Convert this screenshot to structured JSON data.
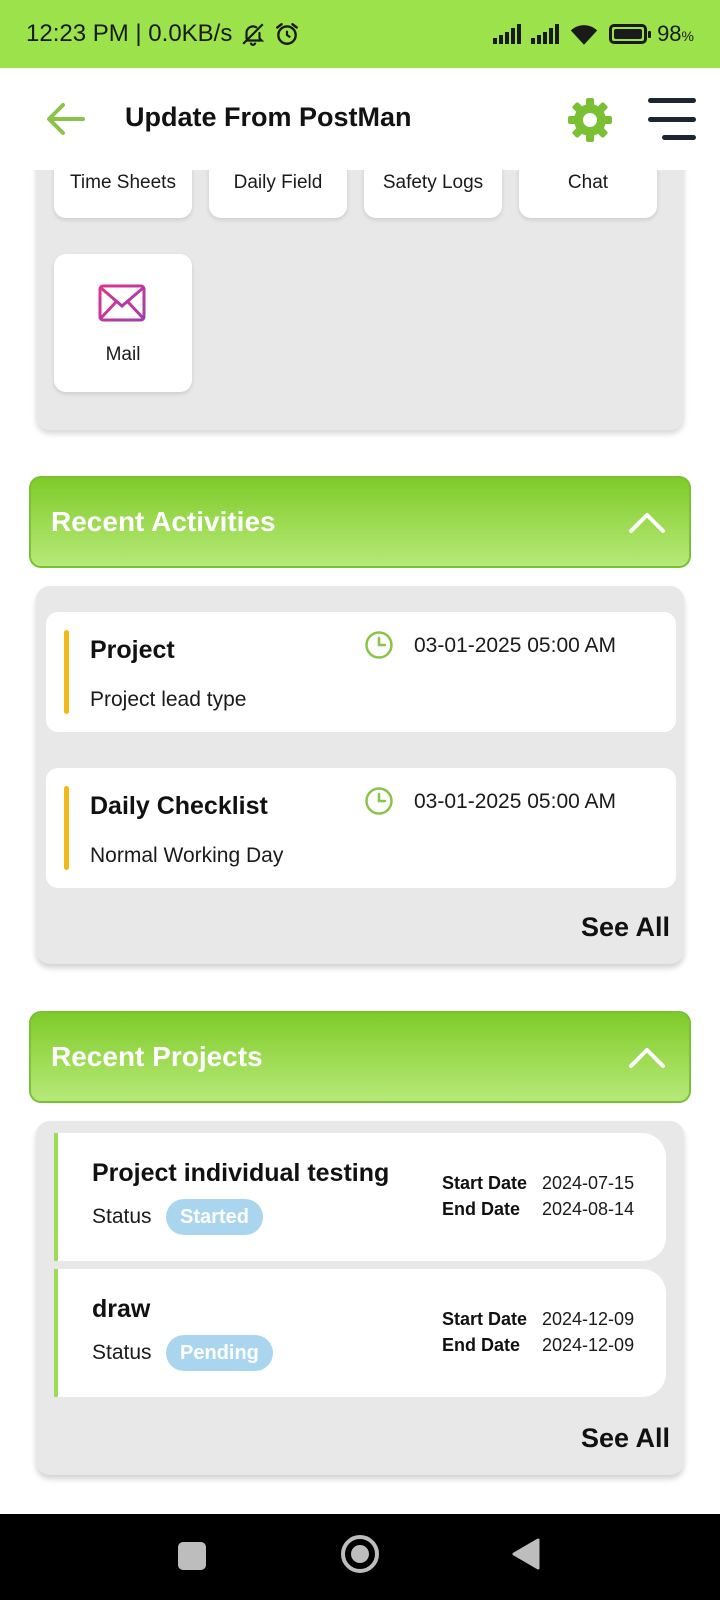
{
  "status_bar": {
    "time": "12:23 PM | 0.0KB/s",
    "battery": "98",
    "battery_unit": "%"
  },
  "header": {
    "title": "Update From PostMan"
  },
  "modules": {
    "top_row": [
      "Time Sheets",
      "Daily Field",
      "Safety Logs",
      "Chat"
    ],
    "mail_label": "Mail"
  },
  "recent_activities": {
    "title": "Recent Activities",
    "items": [
      {
        "title": "Project",
        "subtitle": "Project lead type",
        "time": "03-01-2025 05:00 AM"
      },
      {
        "title": "Daily Checklist",
        "subtitle": "Normal Working Day",
        "time": "03-01-2025 05:00 AM"
      }
    ],
    "see_all": "See All"
  },
  "recent_projects": {
    "title": "Recent Projects",
    "status_label": "Status",
    "start_label": "Start Date",
    "end_label": "End Date",
    "items": [
      {
        "name": "Project individual testing",
        "status": "Started",
        "start": "2024-07-15",
        "end": "2024-08-14"
      },
      {
        "name": "draw",
        "status": "Pending",
        "start": "2024-12-09",
        "end": "2024-12-09"
      }
    ],
    "see_all": "See All"
  },
  "colors": {
    "status_bar": "#9be24b",
    "accent_green": "#8bc34a",
    "activity_bar": "#f2b818",
    "badge": "#a9d6ee"
  }
}
